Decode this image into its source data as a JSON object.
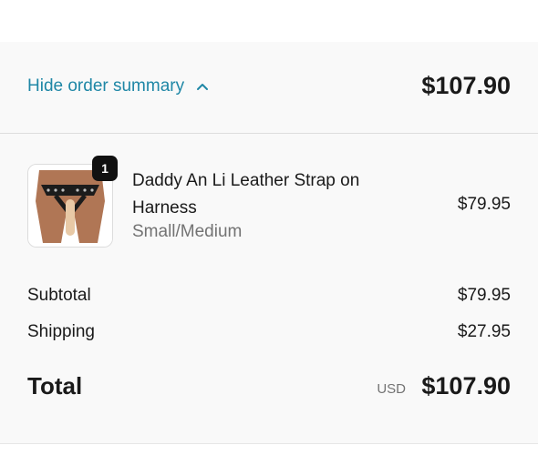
{
  "summary": {
    "toggle_label": "Hide order summary",
    "header_total": "$107.90"
  },
  "product": {
    "quantity_badge": "1",
    "name": "Daddy An Li Leather Strap on Harness",
    "variant": "Small/Medium",
    "price": "$79.95",
    "image_icon": "product-image"
  },
  "lines": {
    "subtotal_label": "Subtotal",
    "subtotal_value": "$79.95",
    "shipping_label": "Shipping",
    "shipping_value": "$27.95"
  },
  "total": {
    "label": "Total",
    "currency": "USD",
    "amount": "$107.90"
  },
  "colors": {
    "link": "#1f87a6",
    "panel_bg": "#f9f9f9",
    "badge_bg": "#111111"
  }
}
